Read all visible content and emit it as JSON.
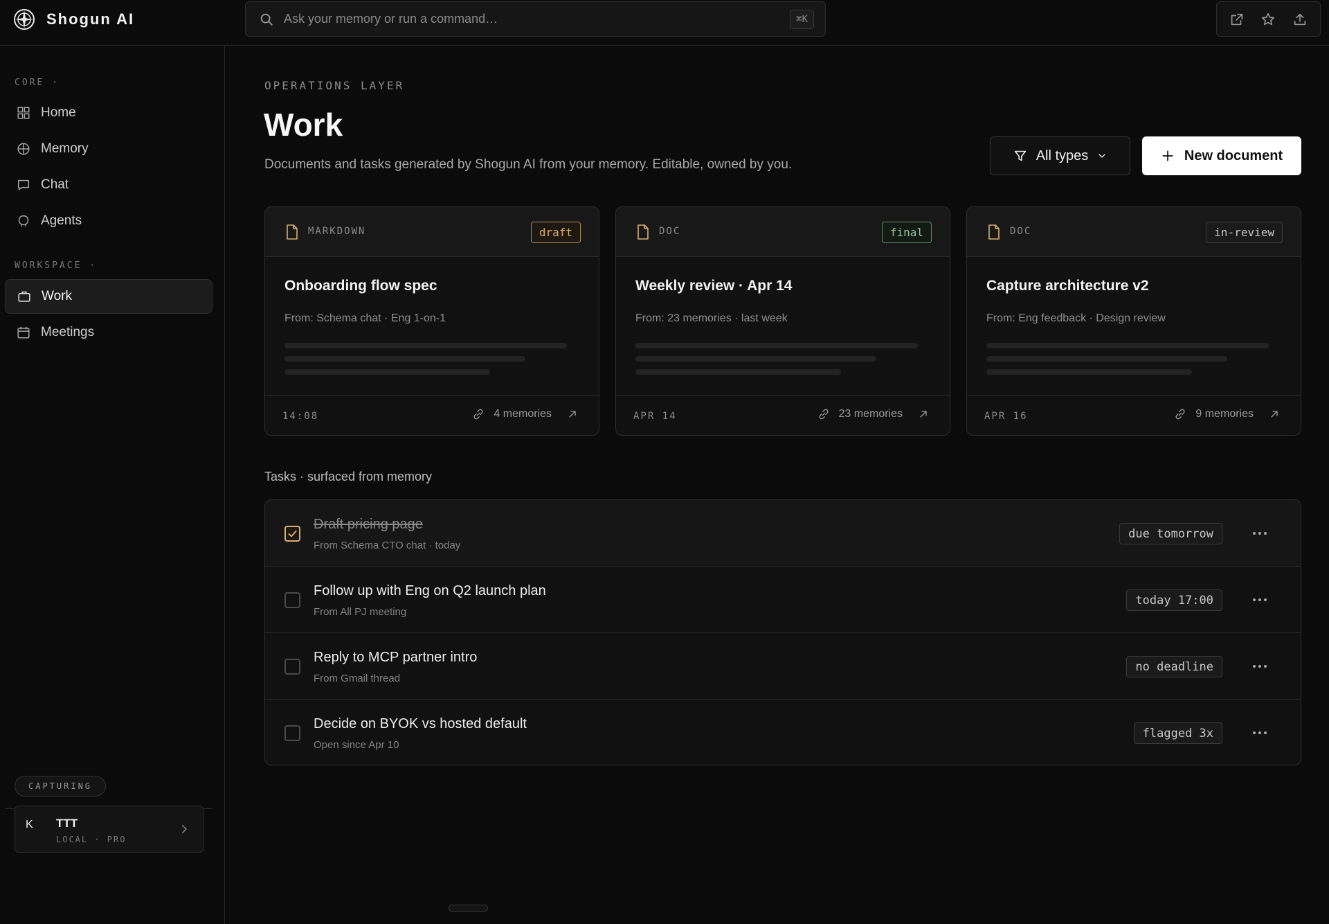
{
  "app": {
    "name": "Shogun AI"
  },
  "search": {
    "placeholder": "Ask your memory or run a command…",
    "shortcut": "⌘K"
  },
  "top_actions": [
    "open-external-icon",
    "star-icon",
    "share-upload-icon"
  ],
  "sidebar": {
    "core_label": "CORE ·",
    "core_items": [
      {
        "label": "Home",
        "icon": "grid-icon"
      },
      {
        "label": "Memory",
        "icon": "globe-icon"
      },
      {
        "label": "Chat",
        "icon": "chat-bubble-icon"
      },
      {
        "label": "Agents",
        "icon": "agent-icon"
      }
    ],
    "workspace_label": "WORKSPACE ·",
    "workspace_items": [
      {
        "label": "Work",
        "icon": "briefcase-icon",
        "active": true
      },
      {
        "label": "Meetings",
        "icon": "calendar-icon",
        "active": false
      }
    ],
    "status_pill": "CAPTURING",
    "account": {
      "avatar": "K",
      "name": "TTT",
      "plan": "LOCAL · PRO"
    }
  },
  "header": {
    "eyebrow": "OPERATIONS LAYER",
    "title": "Work",
    "subtitle": "Documents and tasks generated by Shogun AI from your memory. Editable, owned by you.",
    "filter_label": "All types",
    "new_button_label": "New document"
  },
  "documents": [
    {
      "type": "MARKDOWN",
      "status": "draft",
      "title": "Onboarding flow spec",
      "from": "From: Schema chat · Eng 1-on-1",
      "date": "14:08",
      "memories": "4 memories"
    },
    {
      "type": "DOC",
      "status": "final",
      "title": "Weekly review · Apr 14",
      "from": "From: 23 memories · last week",
      "date": "APR 14",
      "memories": "23 memories"
    },
    {
      "type": "DOC",
      "status": "in-review",
      "title": "Capture architecture v2",
      "from": "From: Eng feedback · Design review",
      "date": "APR 16",
      "memories": "9 memories"
    }
  ],
  "tasks_title": "Tasks · surfaced from memory",
  "tasks": [
    {
      "title": "Draft pricing page",
      "source": "From Schema CTO chat · today",
      "due": "due tomorrow",
      "done": true
    },
    {
      "title": "Follow up with Eng on Q2 launch plan",
      "source": "From All PJ meeting",
      "due": "today 17:00",
      "done": false
    },
    {
      "title": "Reply to MCP partner intro",
      "source": "From Gmail thread",
      "due": "no deadline",
      "done": false
    },
    {
      "title": "Decide on BYOK vs hosted default",
      "source": "Open since Apr 10",
      "due": "flagged 3x",
      "done": false
    }
  ],
  "colors": {
    "accent_draft": "#dcae6e",
    "accent_final": "#93c79a",
    "primary_button": "#ffffff",
    "background": "#0b0b0b"
  }
}
